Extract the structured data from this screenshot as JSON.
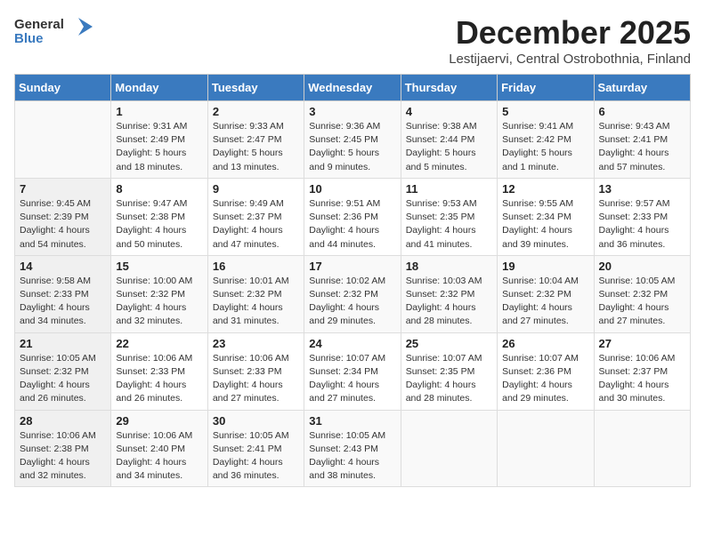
{
  "logo": {
    "general": "General",
    "blue": "Blue"
  },
  "title": "December 2025",
  "subtitle": "Lestijaervi, Central Ostrobothnia, Finland",
  "days_of_week": [
    "Sunday",
    "Monday",
    "Tuesday",
    "Wednesday",
    "Thursday",
    "Friday",
    "Saturday"
  ],
  "weeks": [
    [
      {
        "day": "",
        "content": ""
      },
      {
        "day": "1",
        "content": "Sunrise: 9:31 AM\nSunset: 2:49 PM\nDaylight: 5 hours\nand 18 minutes."
      },
      {
        "day": "2",
        "content": "Sunrise: 9:33 AM\nSunset: 2:47 PM\nDaylight: 5 hours\nand 13 minutes."
      },
      {
        "day": "3",
        "content": "Sunrise: 9:36 AM\nSunset: 2:45 PM\nDaylight: 5 hours\nand 9 minutes."
      },
      {
        "day": "4",
        "content": "Sunrise: 9:38 AM\nSunset: 2:44 PM\nDaylight: 5 hours\nand 5 minutes."
      },
      {
        "day": "5",
        "content": "Sunrise: 9:41 AM\nSunset: 2:42 PM\nDaylight: 5 hours\nand 1 minute."
      },
      {
        "day": "6",
        "content": "Sunrise: 9:43 AM\nSunset: 2:41 PM\nDaylight: 4 hours\nand 57 minutes."
      }
    ],
    [
      {
        "day": "7",
        "content": "Sunrise: 9:45 AM\nSunset: 2:39 PM\nDaylight: 4 hours\nand 54 minutes."
      },
      {
        "day": "8",
        "content": "Sunrise: 9:47 AM\nSunset: 2:38 PM\nDaylight: 4 hours\nand 50 minutes."
      },
      {
        "day": "9",
        "content": "Sunrise: 9:49 AM\nSunset: 2:37 PM\nDaylight: 4 hours\nand 47 minutes."
      },
      {
        "day": "10",
        "content": "Sunrise: 9:51 AM\nSunset: 2:36 PM\nDaylight: 4 hours\nand 44 minutes."
      },
      {
        "day": "11",
        "content": "Sunrise: 9:53 AM\nSunset: 2:35 PM\nDaylight: 4 hours\nand 41 minutes."
      },
      {
        "day": "12",
        "content": "Sunrise: 9:55 AM\nSunset: 2:34 PM\nDaylight: 4 hours\nand 39 minutes."
      },
      {
        "day": "13",
        "content": "Sunrise: 9:57 AM\nSunset: 2:33 PM\nDaylight: 4 hours\nand 36 minutes."
      }
    ],
    [
      {
        "day": "14",
        "content": "Sunrise: 9:58 AM\nSunset: 2:33 PM\nDaylight: 4 hours\nand 34 minutes."
      },
      {
        "day": "15",
        "content": "Sunrise: 10:00 AM\nSunset: 2:32 PM\nDaylight: 4 hours\nand 32 minutes."
      },
      {
        "day": "16",
        "content": "Sunrise: 10:01 AM\nSunset: 2:32 PM\nDaylight: 4 hours\nand 31 minutes."
      },
      {
        "day": "17",
        "content": "Sunrise: 10:02 AM\nSunset: 2:32 PM\nDaylight: 4 hours\nand 29 minutes."
      },
      {
        "day": "18",
        "content": "Sunrise: 10:03 AM\nSunset: 2:32 PM\nDaylight: 4 hours\nand 28 minutes."
      },
      {
        "day": "19",
        "content": "Sunrise: 10:04 AM\nSunset: 2:32 PM\nDaylight: 4 hours\nand 27 minutes."
      },
      {
        "day": "20",
        "content": "Sunrise: 10:05 AM\nSunset: 2:32 PM\nDaylight: 4 hours\nand 27 minutes."
      }
    ],
    [
      {
        "day": "21",
        "content": "Sunrise: 10:05 AM\nSunset: 2:32 PM\nDaylight: 4 hours\nand 26 minutes."
      },
      {
        "day": "22",
        "content": "Sunrise: 10:06 AM\nSunset: 2:33 PM\nDaylight: 4 hours\nand 26 minutes."
      },
      {
        "day": "23",
        "content": "Sunrise: 10:06 AM\nSunset: 2:33 PM\nDaylight: 4 hours\nand 27 minutes."
      },
      {
        "day": "24",
        "content": "Sunrise: 10:07 AM\nSunset: 2:34 PM\nDaylight: 4 hours\nand 27 minutes."
      },
      {
        "day": "25",
        "content": "Sunrise: 10:07 AM\nSunset: 2:35 PM\nDaylight: 4 hours\nand 28 minutes."
      },
      {
        "day": "26",
        "content": "Sunrise: 10:07 AM\nSunset: 2:36 PM\nDaylight: 4 hours\nand 29 minutes."
      },
      {
        "day": "27",
        "content": "Sunrise: 10:06 AM\nSunset: 2:37 PM\nDaylight: 4 hours\nand 30 minutes."
      }
    ],
    [
      {
        "day": "28",
        "content": "Sunrise: 10:06 AM\nSunset: 2:38 PM\nDaylight: 4 hours\nand 32 minutes."
      },
      {
        "day": "29",
        "content": "Sunrise: 10:06 AM\nSunset: 2:40 PM\nDaylight: 4 hours\nand 34 minutes."
      },
      {
        "day": "30",
        "content": "Sunrise: 10:05 AM\nSunset: 2:41 PM\nDaylight: 4 hours\nand 36 minutes."
      },
      {
        "day": "31",
        "content": "Sunrise: 10:05 AM\nSunset: 2:43 PM\nDaylight: 4 hours\nand 38 minutes."
      },
      {
        "day": "",
        "content": ""
      },
      {
        "day": "",
        "content": ""
      },
      {
        "day": "",
        "content": ""
      }
    ]
  ]
}
